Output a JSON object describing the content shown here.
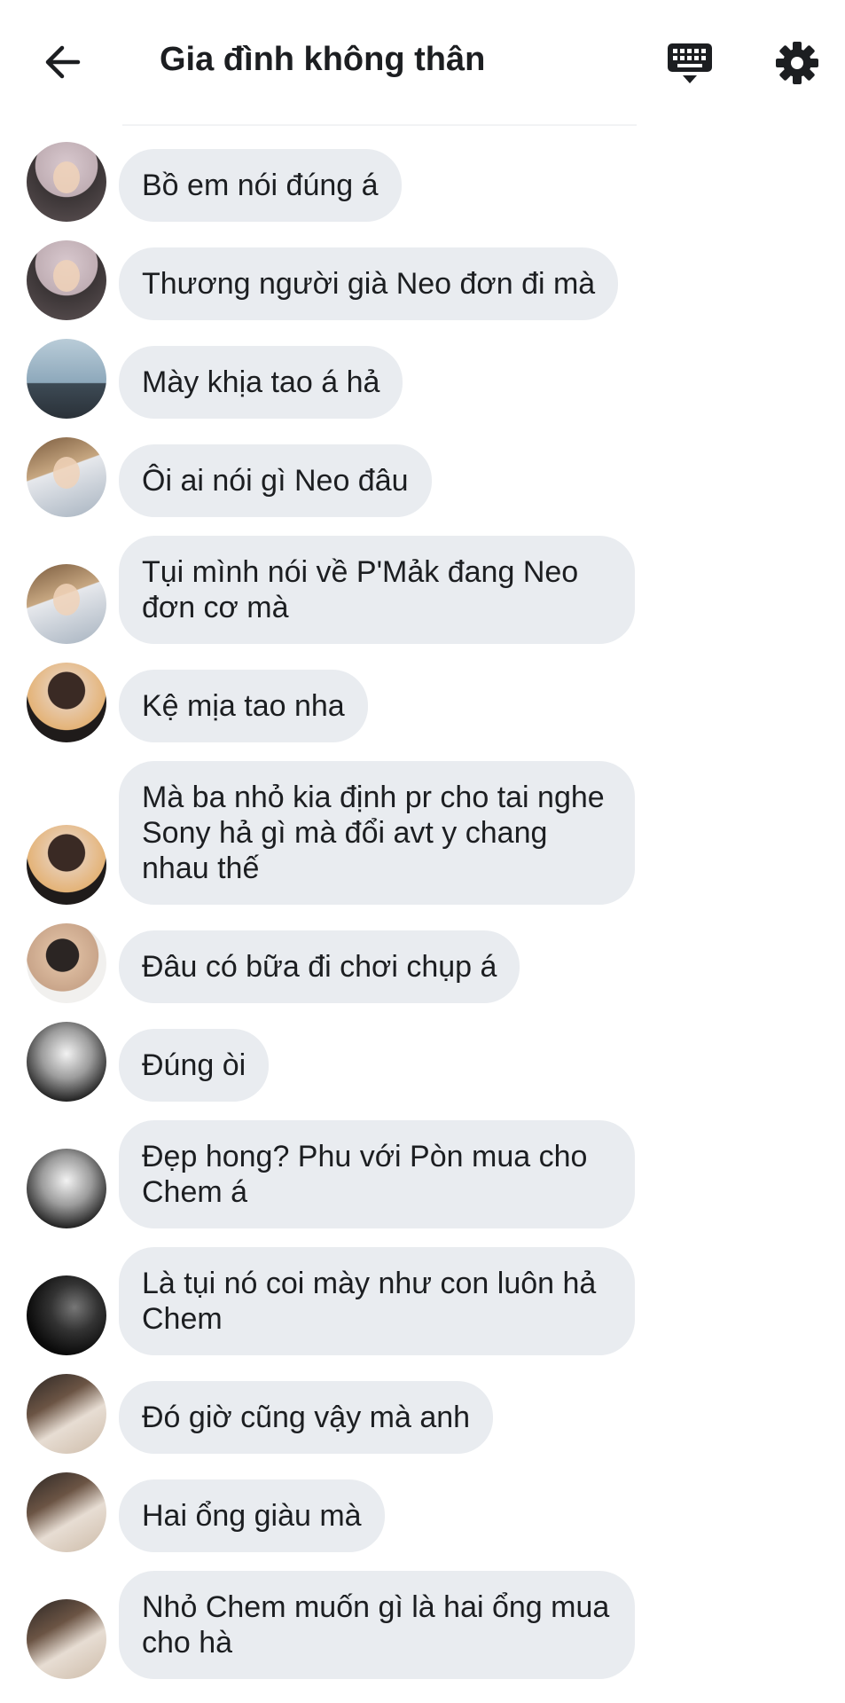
{
  "header": {
    "title": "Gia đình không thân"
  },
  "icons": {
    "back": "arrow-left-icon",
    "keyboard": "keyboard-icon",
    "settings": "gear-icon"
  },
  "colors": {
    "bubble": "#e9ecf0",
    "text": "#1c1e21",
    "background": "#ffffff"
  },
  "messages": [
    {
      "text": "Bồ em nói đúng á"
    },
    {
      "text": "Thương người già Neo đơn đi mà"
    },
    {
      "text": "Mày khịa tao á hả"
    },
    {
      "text": "Ôi ai nói gì Neo đâu"
    },
    {
      "text": "Tụi mình nói về P'Mảk đang Neo đơn cơ mà"
    },
    {
      "text": "Kệ mịa tao nha"
    },
    {
      "text": "Mà ba nhỏ kia định pr cho tai nghe Sony hả gì mà đổi avt y chang nhau thế"
    },
    {
      "text": "Đâu có bữa đi chơi chụp á"
    },
    {
      "text": "Đúng òi"
    },
    {
      "text": "Đẹp hong? Phu với Pòn mua cho Chem á"
    },
    {
      "text": "Là tụi nó coi mày như con luôn hả Chem"
    },
    {
      "text": "Đó giờ cũng vậy mà anh"
    },
    {
      "text": "Hai ổng giàu mà"
    },
    {
      "text": "Nhỏ Chem muốn gì là hai ổng mua cho hà"
    }
  ]
}
